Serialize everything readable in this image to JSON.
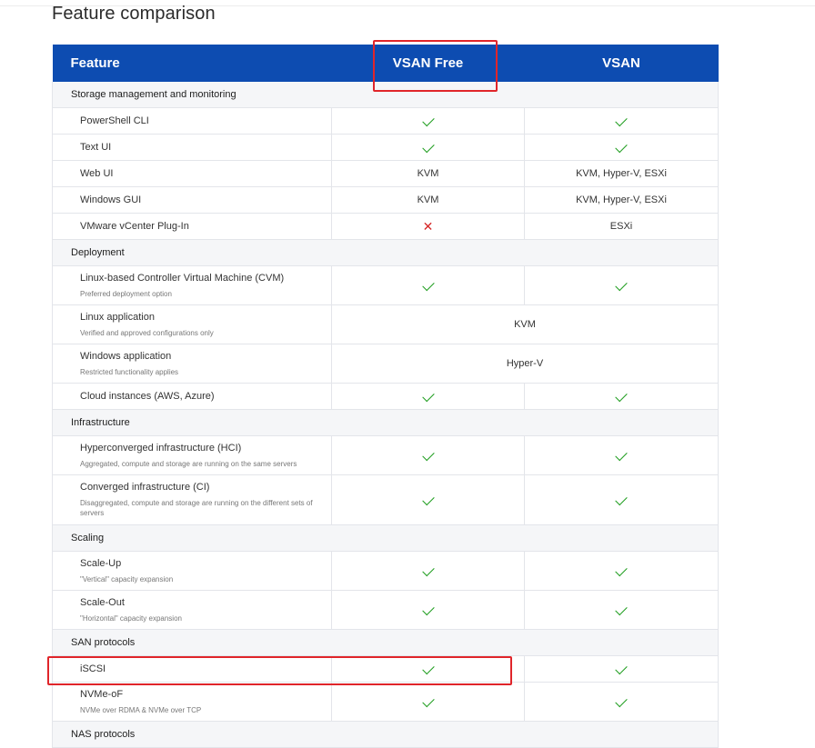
{
  "page": {
    "title": "Feature comparison"
  },
  "header": {
    "feature": "Feature",
    "free": "VSAN Free",
    "vsan": "VSAN"
  },
  "sections": [
    {
      "title": "Storage management and monitoring",
      "rows": [
        {
          "name": "PowerShell CLI",
          "sub": "",
          "free": "check",
          "vsan": "check"
        },
        {
          "name": "Text UI",
          "sub": "",
          "free": "check",
          "vsan": "check"
        },
        {
          "name": "Web UI",
          "sub": "",
          "free": "KVM",
          "vsan": "KVM, Hyper-V, ESXi"
        },
        {
          "name": "Windows GUI",
          "sub": "",
          "free": "KVM",
          "vsan": "KVM, Hyper-V, ESXi"
        },
        {
          "name": "VMware vCenter Plug-In",
          "sub": "",
          "free": "cross",
          "vsan": "ESXi"
        }
      ]
    },
    {
      "title": "Deployment",
      "rows": [
        {
          "name": "Linux-based Controller Virtual Machine (CVM)",
          "sub": "Preferred deployment option",
          "free": "check",
          "vsan": "check"
        },
        {
          "name": "Linux application",
          "sub": "Verified and approved configurations only",
          "span": "KVM"
        },
        {
          "name": "Windows application",
          "sub": "Restricted functionality applies",
          "span": "Hyper-V"
        },
        {
          "name": "Cloud instances (AWS, Azure)",
          "sub": "",
          "free": "check",
          "vsan": "check"
        }
      ]
    },
    {
      "title": "Infrastructure",
      "rows": [
        {
          "name": "Hyperconverged infrastructure (HCI)",
          "sub": "Aggregated, compute and storage are running on the same servers",
          "free": "check",
          "vsan": "check"
        },
        {
          "name": "Converged infrastructure (CI)",
          "sub": "Disaggregated, compute and storage are running on the different sets of servers",
          "free": "check",
          "vsan": "check"
        }
      ]
    },
    {
      "title": "Scaling",
      "rows": [
        {
          "name": "Scale-Up",
          "sub": "\"Vertical\" capacity expansion",
          "free": "check",
          "vsan": "check"
        },
        {
          "name": "Scale-Out",
          "sub": "\"Horizontal\" capacity expansion",
          "free": "check",
          "vsan": "check"
        }
      ]
    },
    {
      "title": "SAN protocols",
      "rows": [
        {
          "name": "iSCSI",
          "sub": "",
          "free": "check",
          "vsan": "check"
        },
        {
          "name": "NVMe-oF",
          "sub": "NVMe over RDMA & NVMe over TCP",
          "free": "check",
          "vsan": "check"
        }
      ]
    },
    {
      "title": "NAS protocols",
      "rows": []
    }
  ]
}
